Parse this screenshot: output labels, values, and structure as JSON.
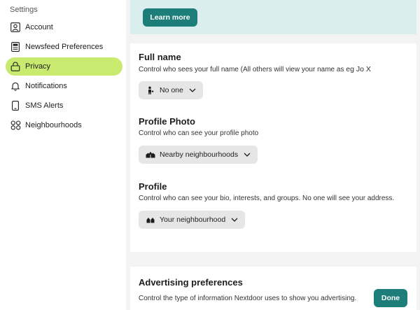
{
  "sidebar": {
    "header": "Settings",
    "items": [
      {
        "label": "Account",
        "icon": "account-icon"
      },
      {
        "label": "Newsfeed Preferences",
        "icon": "newsfeed-icon"
      },
      {
        "label": "Privacy",
        "icon": "lock-icon",
        "active": true
      },
      {
        "label": "Notifications",
        "icon": "bell-icon"
      },
      {
        "label": "SMS Alerts",
        "icon": "phone-icon"
      },
      {
        "label": "Neighbourhoods",
        "icon": "neighbourhoods-icon"
      }
    ]
  },
  "banner": {
    "button_label": "Learn more"
  },
  "privacy": {
    "full_name": {
      "title": "Full name",
      "description": "Control who sees your full name (All others will view your name as",
      "example": "eg Jo X",
      "selected": "No one"
    },
    "profile_photo": {
      "title": "Profile Photo",
      "description": "Control who can see your profile photo",
      "selected": "Nearby neighbourhoods"
    },
    "profile": {
      "title": "Profile",
      "description": "Control who can see your bio, interests, and groups. No one will see your address.",
      "selected": "Your neighbourhood"
    }
  },
  "advertising": {
    "title": "Advertising preferences",
    "description": "Control the type of information Nextdoor uses to show you advertising.",
    "done_label": "Done"
  },
  "colors": {
    "accent": "#1c7d79",
    "active_nav": "#c8ea6e",
    "banner_bg": "#daeeed"
  }
}
